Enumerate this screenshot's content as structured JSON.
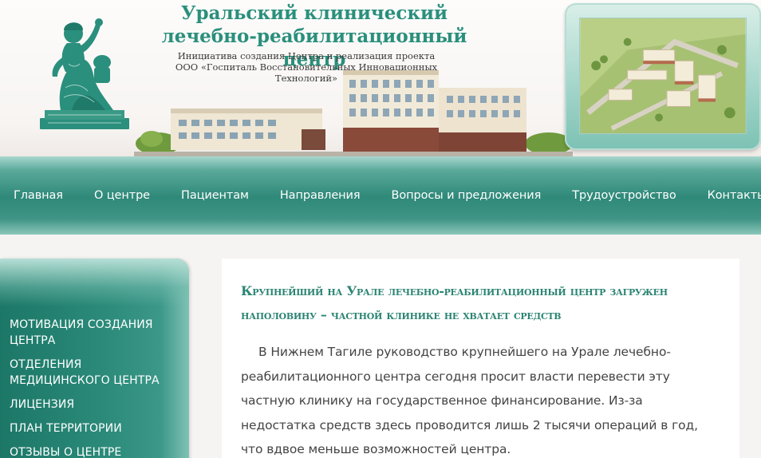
{
  "header": {
    "title_line1": "Уральский клинический",
    "title_line2": "лечебно-реабилитационный центр",
    "subtitle_line1": "Инициатива создания Центра и реализация проекта",
    "subtitle_line2": "ООО «Госпиталь Восстановительных Инновационных",
    "subtitle_line3": "Технологий»"
  },
  "nav": {
    "items": [
      {
        "label": "Главная"
      },
      {
        "label": "О центре"
      },
      {
        "label": "Пациентам"
      },
      {
        "label": "Направления"
      },
      {
        "label": "Вопросы и предложения"
      },
      {
        "label": "Трудоустройство"
      },
      {
        "label": "Контакты"
      }
    ]
  },
  "sidebar": {
    "items": [
      {
        "label": "Мотивация создания центра"
      },
      {
        "label": "Отделения медицинского центра"
      },
      {
        "label": "Лицензия"
      },
      {
        "label": "План территории"
      },
      {
        "label": "Отзывы о центре"
      }
    ]
  },
  "article": {
    "title": "Крупнейший на Урале лечебно-реабилитационный центр загружен наполовину – частной клинике не хватает средств",
    "body": "В Нижнем Тагиле руководство крупнейшего на Урале лечебно-реабилитационного центра сегодня просит власти перевести эту частную клинику на государственное финансирование. Из-за недостатка средств здесь проводится лишь 2 тысячи операций в год, что вдвое меньше возможностей центра."
  },
  "colors": {
    "brand_green": "#2a8f7c",
    "nav_teal": "#2f8979",
    "article_title": "#2a8472"
  }
}
